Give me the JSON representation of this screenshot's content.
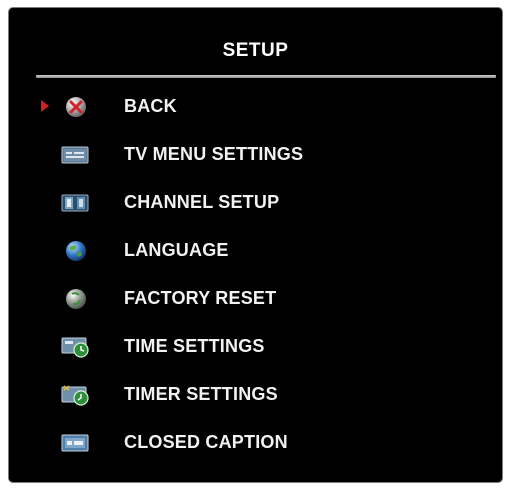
{
  "menu": {
    "title": "SETUP",
    "items": [
      {
        "label": "BACK",
        "icon": "back-icon",
        "selected": true
      },
      {
        "label": "TV MENU SETTINGS",
        "icon": "tv-menu-settings-icon",
        "selected": false
      },
      {
        "label": "CHANNEL SETUP",
        "icon": "channel-setup-icon",
        "selected": false
      },
      {
        "label": "LANGUAGE",
        "icon": "globe-icon",
        "selected": false
      },
      {
        "label": "FACTORY RESET",
        "icon": "factory-reset-icon",
        "selected": false
      },
      {
        "label": "TIME SETTINGS",
        "icon": "clock-icon",
        "selected": false
      },
      {
        "label": "TIMER SETTINGS",
        "icon": "timer-icon",
        "selected": false
      },
      {
        "label": "CLOSED CAPTION",
        "icon": "closed-caption-icon",
        "selected": false
      }
    ]
  },
  "colors": {
    "background": "#000000",
    "text": "#f2f2f2",
    "selection_arrow": "#d32020"
  }
}
